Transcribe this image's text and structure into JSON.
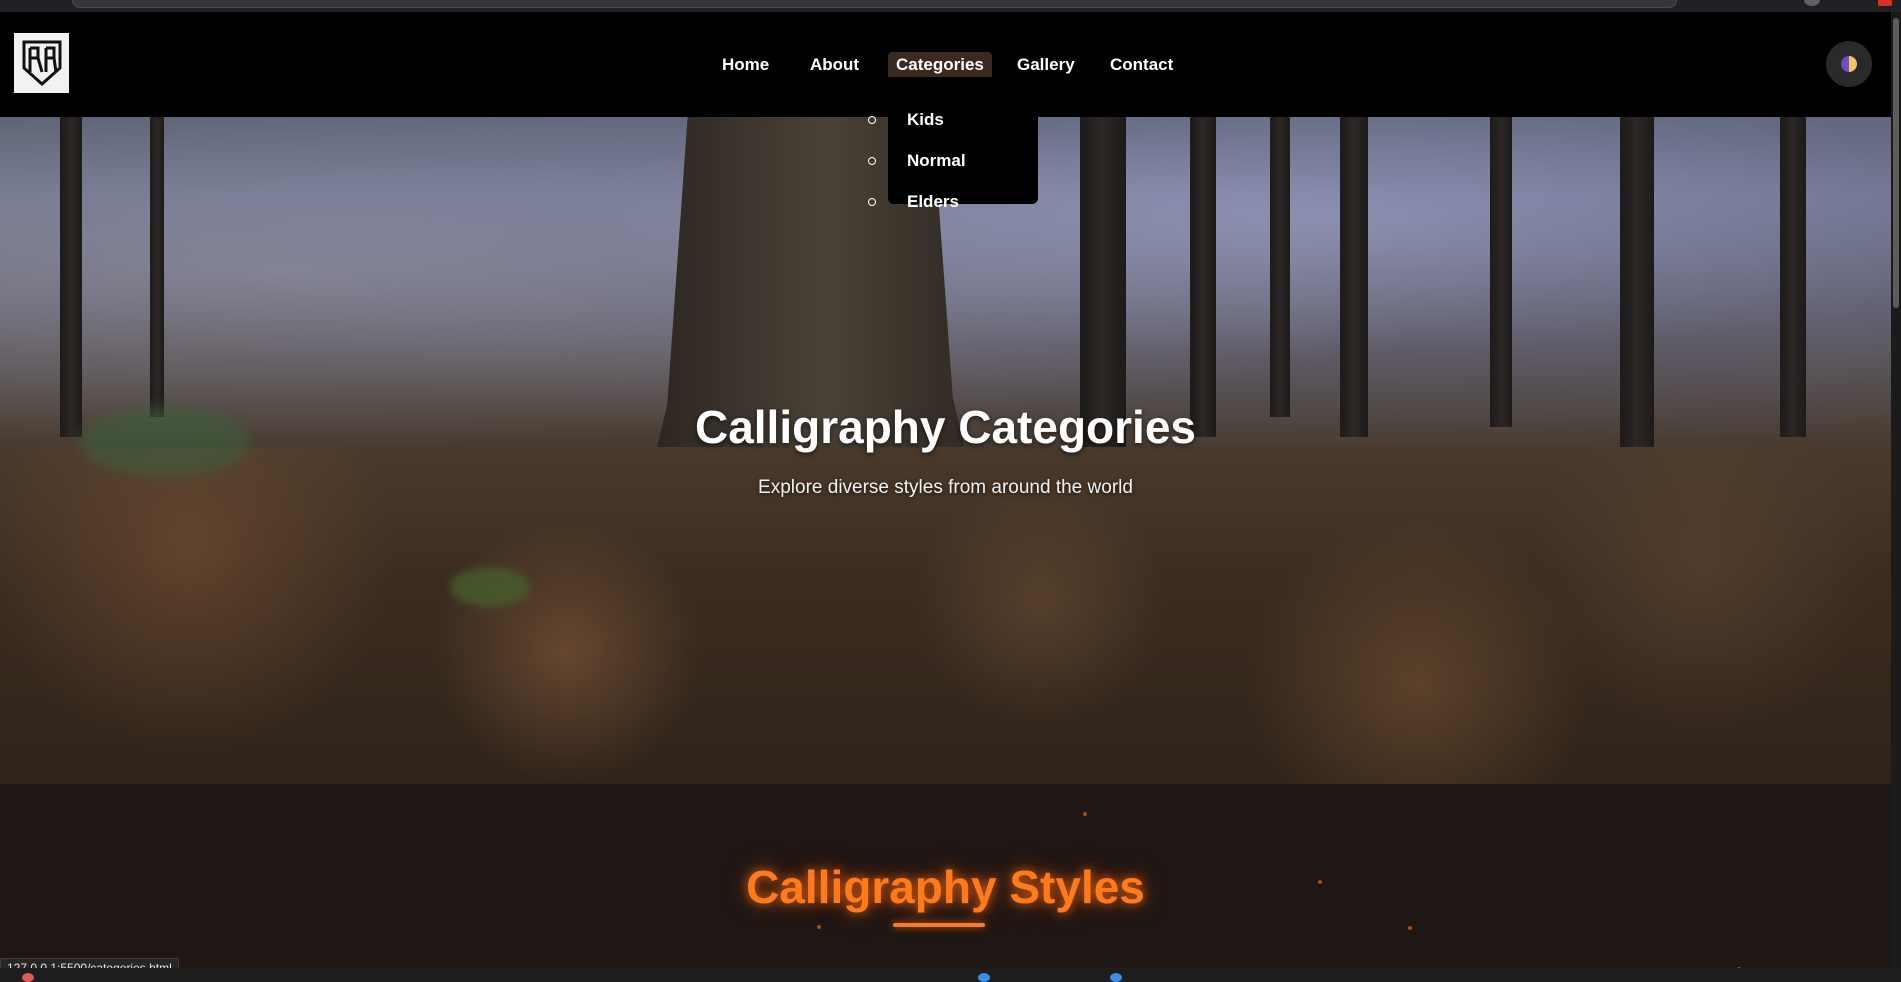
{
  "nav": {
    "items": [
      {
        "label": "Home",
        "active": false
      },
      {
        "label": "About",
        "active": false
      },
      {
        "label": "Categories",
        "active": true
      },
      {
        "label": "Gallery",
        "active": false
      },
      {
        "label": "Contact",
        "active": false
      }
    ],
    "dropdown": [
      "Kids",
      "Normal",
      "Elders"
    ]
  },
  "hero": {
    "title": "Calligraphy Categories",
    "subtitle": "Explore diverse styles from around the world"
  },
  "section": {
    "title": "Calligraphy Styles"
  },
  "status": {
    "url": "127.0.0.1:5500/categories.html"
  },
  "colors": {
    "accent": "#ff7a1a",
    "nav_bg": "#000000",
    "section_bg": "#1f1714"
  },
  "icons": {
    "logo": "monogram-logo-icon",
    "theme": "theme-toggle-icon"
  }
}
